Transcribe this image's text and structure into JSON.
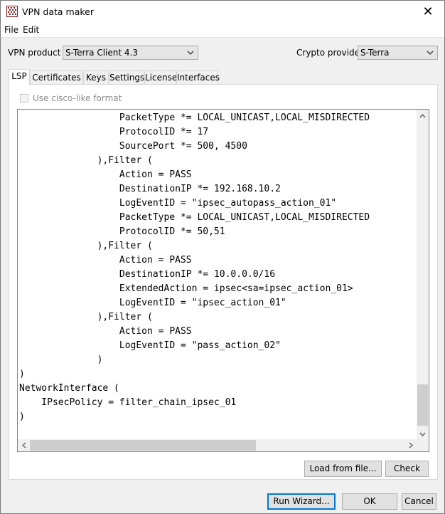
{
  "window": {
    "title": "VPN data maker",
    "close_glyph": "✕"
  },
  "menu": {
    "items": [
      "File",
      "Edit"
    ]
  },
  "top": {
    "vpn_product_label": "VPN product",
    "vpn_product_value": "S-Terra Client 4.3",
    "crypto_provider_label": "Crypto provider",
    "crypto_provider_value": "S-Terra"
  },
  "tabs": [
    "LSP",
    "Certificates",
    "Keys",
    "Settings",
    "License",
    "Interfaces"
  ],
  "active_tab": "LSP",
  "lsp": {
    "cisco_format_label": "Use cisco-like format",
    "cisco_format_checked": false,
    "code_lines": [
      "                  PacketType *= LOCAL_UNICAST,LOCAL_MISDIRECTED",
      "                  ProtocolID *= 17",
      "                  SourcePort *= 500, 4500",
      "              ),Filter (",
      "                  Action = PASS",
      "                  DestinationIP *= 192.168.10.2",
      "                  LogEventID = \"ipsec_autopass_action_01\"",
      "                  PacketType *= LOCAL_UNICAST,LOCAL_MISDIRECTED",
      "                  ProtocolID *= 50,51",
      "              ),Filter (",
      "                  Action = PASS",
      "                  DestinationIP *= 10.0.0.0/16",
      "                  ExtendedAction = ipsec<sa=ipsec_action_01>",
      "                  LogEventID = \"ipsec_action_01\"",
      "              ),Filter (",
      "                  Action = PASS",
      "                  LogEventID = \"pass_action_02\"",
      "              )",
      ")",
      "NetworkInterface (",
      "    IPsecPolicy = filter_chain_ipsec_01",
      ")"
    ],
    "load_button": "Load from file...",
    "check_button": "Check"
  },
  "footer": {
    "run_wizard": "Run Wizard...",
    "ok": "OK",
    "cancel": "Cancel"
  },
  "colors": {
    "accent": "#0078d7",
    "window_bg": "#f0f0f0",
    "border": "#adadad"
  }
}
